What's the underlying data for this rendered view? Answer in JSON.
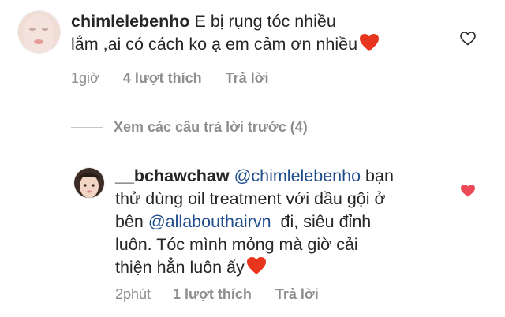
{
  "comment": {
    "username": "chimlelebenho",
    "text_line1": "E bị rụng tóc nhiều",
    "text_line2": "lắm ,ai có cách ko ạ em cảm ơn nhiều",
    "time": "1giờ",
    "likes": "4 lượt thích",
    "reply_label": "Trả lời",
    "liked": false
  },
  "view_replies": {
    "label": "Xem các câu trả lời trước (4)"
  },
  "reply": {
    "username": "__bchawchaw",
    "mention_user": "@chimlelebenho",
    "text_a": " bạn",
    "text_line2": "thử dùng oil treatment với dầu gội ở",
    "text_b": "bên ",
    "mention_brand": "@allabouthairvn",
    "text_c": "  đi, siêu đỉnh",
    "text_line4": "luôn. Tóc mình mỏng mà giờ cải",
    "text_line5": "thiện hẳn luôn ấy",
    "time": "2phút",
    "likes": "1 lượt thích",
    "reply_label": "Trả lời",
    "liked": true
  },
  "colors": {
    "heart_liked": "#ed4956",
    "emoji_heart": "#e8361e",
    "mention": "#1f4d8b",
    "meta": "#8e8e8e"
  }
}
